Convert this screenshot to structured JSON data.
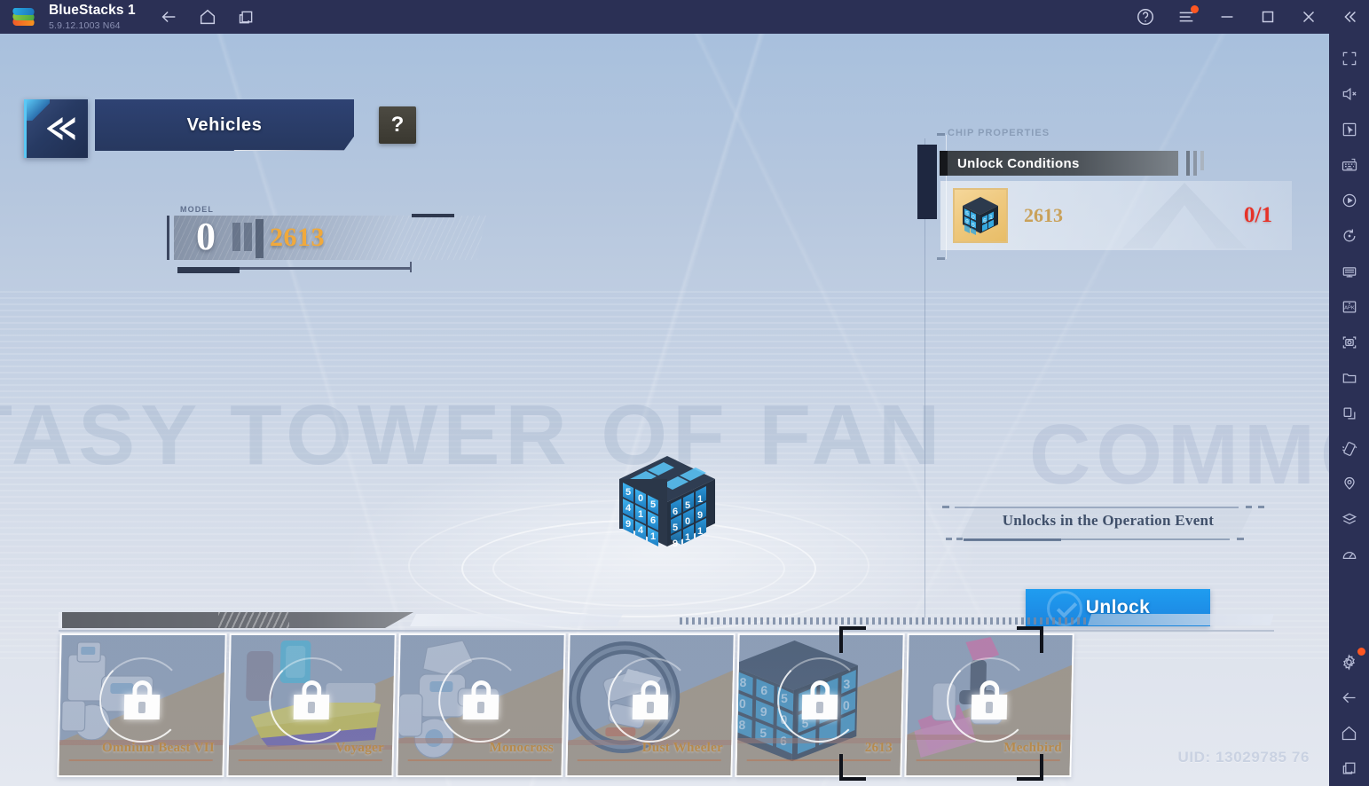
{
  "titlebar": {
    "app_name": "BlueStacks 1",
    "version": "5.9.12.1003  N64",
    "nav": [
      {
        "name": "back-icon",
        "label": "Back"
      },
      {
        "name": "home-icon",
        "label": "Home"
      },
      {
        "name": "multi-instance-icon",
        "label": "Multi-instance"
      }
    ],
    "right_controls": [
      {
        "name": "help-icon",
        "label": "Help"
      },
      {
        "name": "menu-icon",
        "label": "Menu",
        "badge": true
      },
      {
        "name": "minimize-icon",
        "label": "Minimize"
      },
      {
        "name": "maximize-icon",
        "label": "Maximize"
      },
      {
        "name": "close-icon",
        "label": "Close"
      },
      {
        "name": "collapse-sidebar-icon",
        "label": "Collapse"
      }
    ]
  },
  "sidebar": {
    "items": [
      {
        "name": "fullscreen-icon",
        "label": "Full screen"
      },
      {
        "name": "mute-icon",
        "label": "Mute"
      },
      {
        "name": "pointer-icon",
        "label": "Game controls"
      },
      {
        "name": "keymapping-icon",
        "label": "Keymapping"
      },
      {
        "name": "macro-icon",
        "label": "Macros"
      },
      {
        "name": "rotate-icon",
        "label": "Rotate"
      },
      {
        "name": "multi-instance-manager-icon",
        "label": "Instance manager"
      },
      {
        "name": "install-apk-icon",
        "label": "Install APK"
      },
      {
        "name": "screenshot-icon",
        "label": "Screenshot"
      },
      {
        "name": "media-folder-icon",
        "label": "Media manager"
      },
      {
        "name": "copy-to-instance-icon",
        "label": "Copy to instance"
      },
      {
        "name": "shake-icon",
        "label": "Shake"
      },
      {
        "name": "location-icon",
        "label": "Location"
      },
      {
        "name": "layers-icon",
        "label": "Eco mode"
      },
      {
        "name": "performance-icon",
        "label": "Performance"
      },
      {
        "name": "settings-icon",
        "label": "Settings",
        "badge": true
      },
      {
        "name": "back-icon",
        "label": "Back"
      },
      {
        "name": "home-icon",
        "label": "Home"
      },
      {
        "name": "recents-icon",
        "label": "Recent apps"
      }
    ]
  },
  "game": {
    "background_watermark": "NTASY TOWER OF FAN",
    "panel_watermark": "COMMODITIES",
    "header": {
      "back_label": "Back",
      "title": "Vehicles",
      "help_label": "?"
    },
    "model": {
      "label": "MODEL",
      "number": "0",
      "name": "2613"
    },
    "chip_panel": {
      "panel_title": "CHIP PROPERTIES",
      "section_title": "Unlock Conditions",
      "requirement": {
        "name": "2613",
        "count": "0/1",
        "icon": "cube-icon"
      },
      "event_note": "Unlocks in the Operation Event",
      "unlock_button": "Unlock"
    },
    "dock": {
      "cards": [
        {
          "name": "Omnium Beast VII",
          "locked": true,
          "selected": false,
          "art": "mech-white"
        },
        {
          "name": "Voyager",
          "locked": true,
          "selected": false,
          "art": "car-yellow"
        },
        {
          "name": "Monocross",
          "locked": true,
          "selected": false,
          "art": "mech-silver"
        },
        {
          "name": "Dust Wheeler",
          "locked": true,
          "selected": false,
          "art": "wheel-dark"
        },
        {
          "name": "2613",
          "locked": true,
          "selected": true,
          "art": "cube-blue"
        },
        {
          "name": "Mechbird",
          "locked": true,
          "selected": false,
          "art": "bird-pink"
        }
      ]
    },
    "uid": "UID: 13029785 76"
  },
  "colors": {
    "titlebar_bg": "#2b3055",
    "accent_blue": "#1f9df0",
    "gold": "#f0a93c",
    "danger_red": "#e63228",
    "card_name": "#b68a4d"
  }
}
